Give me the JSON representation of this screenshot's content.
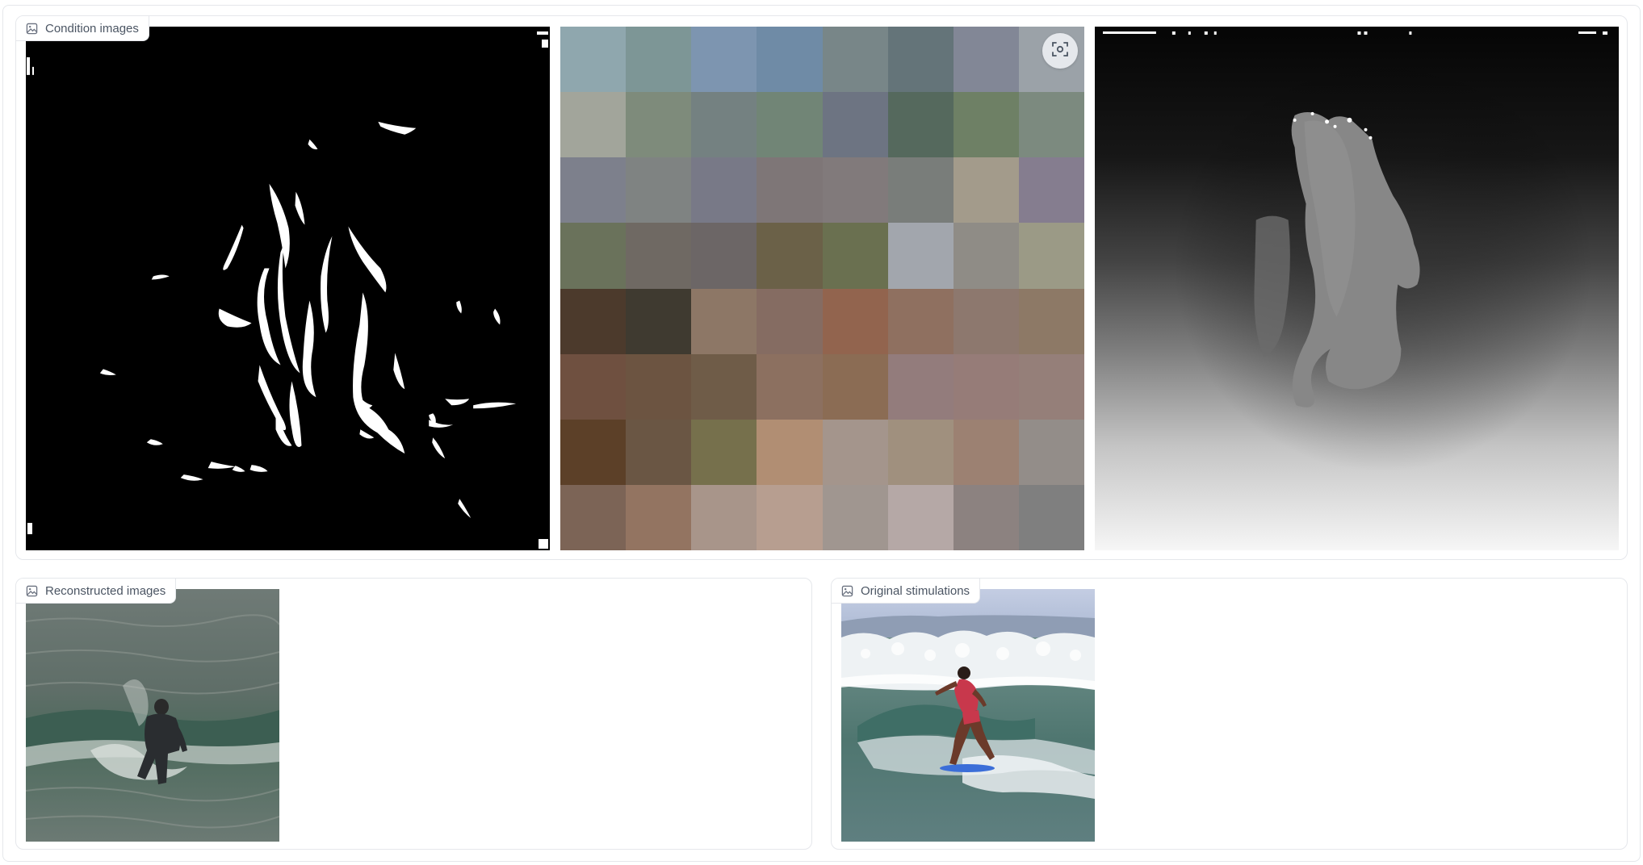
{
  "panels": {
    "condition": {
      "label": "Condition images"
    },
    "reconstructed": {
      "label": "Reconstructed images"
    },
    "original": {
      "label": "Original stimulations"
    }
  },
  "icons": {
    "panel_label_icon": "image-icon",
    "zoom_button_icon": "focus-camera-icon"
  },
  "color_palette": {
    "rows": [
      [
        "#8fa7ae",
        "#7d9696",
        "#7d95b0",
        "#6f8ba6",
        "#788688",
        "#647479",
        "#828796",
        "#9ba2a8"
      ],
      [
        "#a2a59b",
        "#7e8b7b",
        "#748181",
        "#718576",
        "#6d7482",
        "#55695d",
        "#6e8065",
        "#7c8a7f"
      ],
      [
        "#7d808c",
        "#7f8382",
        "#787987",
        "#7e7677",
        "#817a7b",
        "#797d7a",
        "#a39b8b",
        "#857d8f"
      ],
      [
        "#6a725b",
        "#6f6963",
        "#6c6666",
        "#6b6148",
        "#6a7050",
        "#a2a6ad",
        "#8f8c86",
        "#9b9a86"
      ],
      [
        "#4c3a2c",
        "#3f3a30",
        "#8d7766",
        "#856c62",
        "#92644e",
        "#8f7060",
        "#8d786e",
        "#8d7966"
      ],
      [
        "#6f5040",
        "#6c5441",
        "#6f5c48",
        "#8c7060",
        "#8b6c54",
        "#937c7c",
        "#967c78",
        "#957f79"
      ],
      [
        "#5c4028",
        "#6a5644",
        "#76704c",
        "#b18e73",
        "#a4958c",
        "#a0907e",
        "#9c8172",
        "#938d89"
      ],
      [
        "#7c6456",
        "#937461",
        "#a8958a",
        "#b79e90",
        "#a09690",
        "#b5a8a6",
        "#8c8280",
        "#7f7f7f"
      ]
    ]
  }
}
